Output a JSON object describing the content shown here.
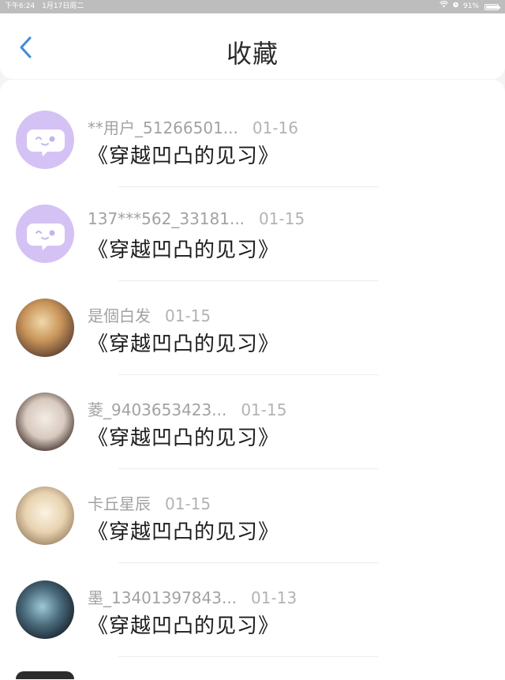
{
  "status_bar": {
    "time": "下午6:24",
    "date": "1月17日周二",
    "wifi_icon": "wifi-icon",
    "alarm_icon": "alarm-icon",
    "battery_text": "91%",
    "battery_level": 0.91
  },
  "header": {
    "title": "收藏",
    "back_icon": "chevron-left-icon",
    "accent_color": "#3d8bd8"
  },
  "items": [
    {
      "user": "**用户_51266501...",
      "date": "01-16",
      "book": "《穿越凹凸的见习》",
      "avatar": "default-chat-bubble-avatar"
    },
    {
      "user": "137***562_33181...",
      "date": "01-15",
      "book": "《穿越凹凸的见习》",
      "avatar": "default-chat-bubble-avatar"
    },
    {
      "user": "是個白发",
      "date": "01-15",
      "book": "《穿越凹凸的见习》",
      "avatar": "user-photo-avatar"
    },
    {
      "user": "菱_9403653423...",
      "date": "01-15",
      "book": "《穿越凹凸的见习》",
      "avatar": "user-photo-avatar"
    },
    {
      "user": "卡丘星辰",
      "date": "01-15",
      "book": "《穿越凹凸的见习》",
      "avatar": "user-photo-avatar"
    },
    {
      "user": "墨_13401397843...",
      "date": "01-13",
      "book": "《穿越凹凸的见习》",
      "avatar": "user-photo-avatar"
    }
  ]
}
